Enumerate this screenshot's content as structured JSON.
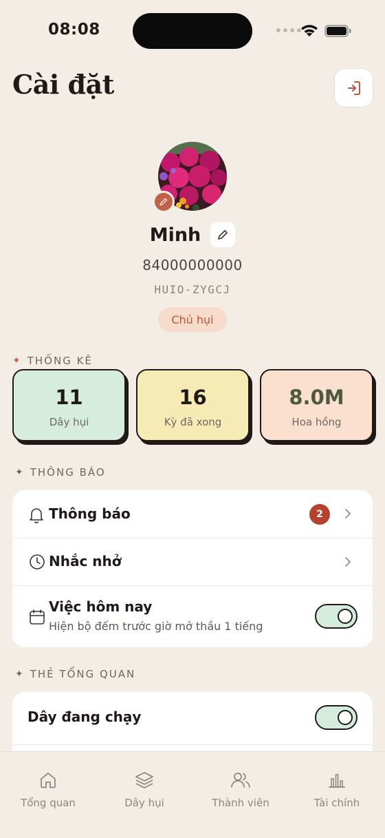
{
  "status_bar": {
    "time": "08:08"
  },
  "header": {
    "title": "Cài đặt"
  },
  "profile": {
    "name": "Minh",
    "phone": "84000000000",
    "code": "HUIO-ZYGCJ",
    "role": "Chủ hụi"
  },
  "stats": {
    "section_label": "THỐNG KÊ",
    "items": [
      {
        "value": "11",
        "label": "Dây hụi",
        "bg": "#d6ecdc",
        "color": "#1f1a17"
      },
      {
        "value": "16",
        "label": "Kỳ đã xong",
        "bg": "#f7ebb5",
        "color": "#1f1a17"
      },
      {
        "value": "8.0M",
        "label": "Hoa hồng",
        "bg": "#fbdfcf",
        "color": "#4e5a3e"
      }
    ]
  },
  "notifications": {
    "section_label": "THÔNG BÁO",
    "items": [
      {
        "title": "Thông báo",
        "badge": "2",
        "icon": "bell-icon"
      },
      {
        "title": "Nhắc nhở",
        "icon": "clock-icon"
      },
      {
        "title": "Việc hôm nay",
        "subtitle": "Hiện bộ đếm trước giờ mở thầu 1 tiếng",
        "icon": "calendar-icon",
        "toggle_on": true
      }
    ]
  },
  "overview_cards": {
    "section_label": "THẺ TỔNG QUAN",
    "items": [
      {
        "title": "Dây đang chạy",
        "toggle_on": true
      }
    ]
  },
  "bottom_nav": {
    "items": [
      {
        "label": "Tổng quan",
        "icon": "home-icon"
      },
      {
        "label": "Dây hụi",
        "icon": "layers-icon"
      },
      {
        "label": "Thành viên",
        "icon": "users-icon"
      },
      {
        "label": "Tài chính",
        "icon": "bar-chart-icon"
      }
    ]
  },
  "colors": {
    "background": "#f3ede5",
    "accent": "#c0533a",
    "badge": "#b5422d",
    "toggle_on": "#d3ecdc"
  }
}
